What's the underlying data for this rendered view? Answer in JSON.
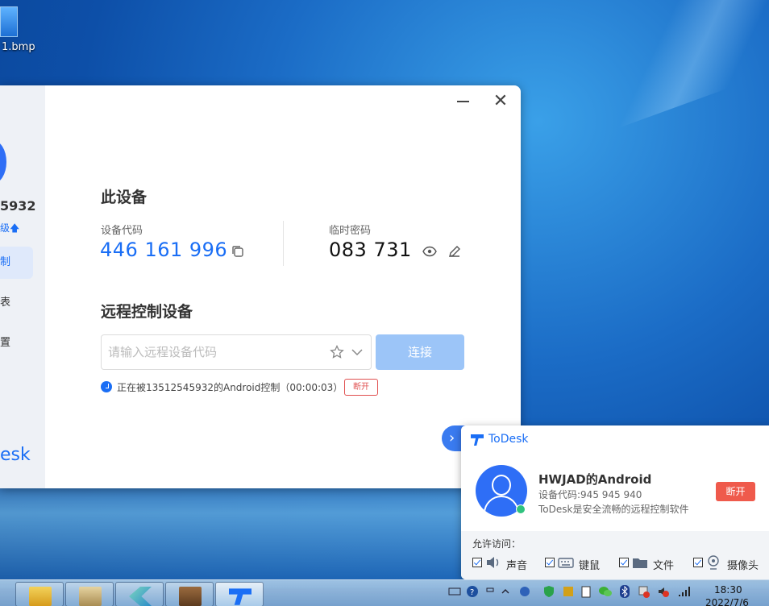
{
  "desktop": {
    "icon_label": "1.bmp"
  },
  "window": {
    "sidebar": {
      "id_partial": "5932",
      "upgrade_partial": "级",
      "nav": [
        "制",
        "表",
        "置"
      ],
      "logo_partial": "esk"
    },
    "this_device": {
      "title": "此设备",
      "device_code_label": "设备代码",
      "device_code": "446 161 996",
      "temp_password_label": "临时密码",
      "temp_password": "083 731"
    },
    "remote": {
      "title": "远程控制设备",
      "placeholder": "请输入远程设备代码",
      "value": "",
      "connect_label": "连接"
    },
    "status": {
      "text": "正在被13512545932的Android控制（00:00:03）",
      "disconnect_label": "断开"
    }
  },
  "popup": {
    "brand": "ToDesk",
    "name": "HWJAD的Android",
    "code_line": "设备代码:945 945 940",
    "tagline": "ToDesk是安全流畅的远程控制软件",
    "disconnect_label": "断开",
    "allow_label": "允许访问：",
    "permissions": [
      {
        "label": "声音",
        "checked": true
      },
      {
        "label": "键鼠",
        "checked": true
      },
      {
        "label": "文件",
        "checked": true
      },
      {
        "label": "摄像头",
        "checked": true
      }
    ]
  },
  "taskbar": {
    "time": "18:30",
    "date": "2022/7/6"
  },
  "colors": {
    "accent": "#1a6ef5",
    "danger": "#ef5a4c",
    "connect_disabled": "#9cc5f8"
  }
}
